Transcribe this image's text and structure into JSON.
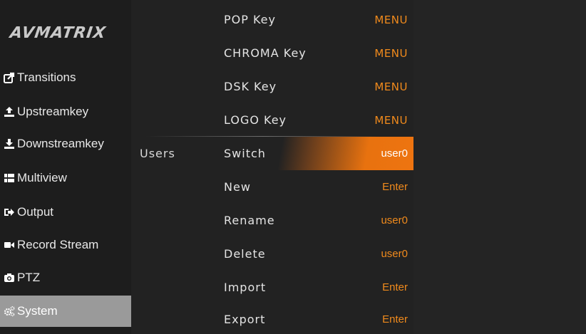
{
  "brand": {
    "logo": "AVMATRIX"
  },
  "sidebar": {
    "items": [
      {
        "label": "Transitions",
        "icon": "share-icon"
      },
      {
        "label": "Upstreamkey",
        "icon": "upload-icon"
      },
      {
        "label": "Downstreamkey",
        "icon": "download-icon"
      },
      {
        "label": "Multiview",
        "icon": "grid-icon"
      },
      {
        "label": "Output",
        "icon": "sign-out-icon"
      },
      {
        "label": "Record Stream",
        "icon": "video-camera-icon"
      },
      {
        "label": "PTZ",
        "icon": "camera-icon"
      },
      {
        "label": "System",
        "icon": "gears-icon"
      }
    ],
    "active": "System"
  },
  "panel": {
    "rows": [
      {
        "group": "",
        "label": "POP Key",
        "value": "MENU"
      },
      {
        "group": "",
        "label": "CHROMA Key",
        "value": "MENU"
      },
      {
        "group": "",
        "label": "DSK Key",
        "value": "MENU"
      },
      {
        "group": "",
        "label": "LOGO Key",
        "value": "MENU"
      },
      {
        "group": "Users",
        "label": "Switch",
        "value": "user0"
      },
      {
        "group": "",
        "label": "New",
        "value": "Enter"
      },
      {
        "group": "",
        "label": "Rename",
        "value": "user0"
      },
      {
        "group": "",
        "label": "Delete",
        "value": "user0"
      },
      {
        "group": "",
        "label": "Import",
        "value": "Enter"
      },
      {
        "group": "",
        "label": "Export",
        "value": "Enter"
      }
    ],
    "selected_row": "Switch"
  },
  "colors": {
    "accent": "#f08a1c",
    "highlight": "#e8720f",
    "active_nav": "#9a9a9a"
  }
}
